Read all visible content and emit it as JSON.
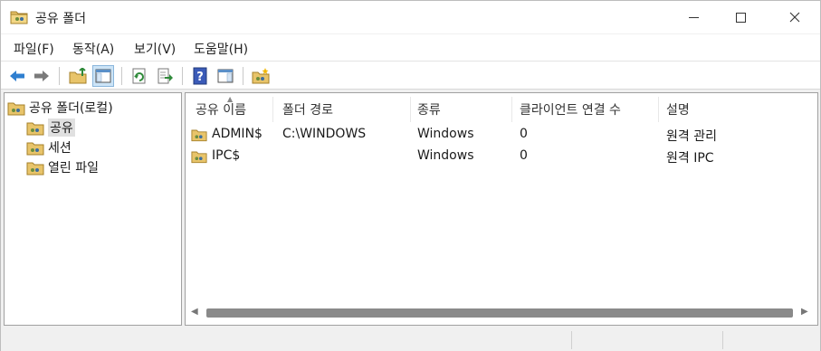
{
  "window": {
    "title": "공유 폴더"
  },
  "menubar": {
    "items": [
      "파일(F)",
      "동작(A)",
      "보기(V)",
      "도움말(H)"
    ]
  },
  "toolbar": {
    "buttons": [
      {
        "icon": "back-arrow-icon"
      },
      {
        "icon": "forward-arrow-icon"
      },
      {
        "icon": "up-folder-icon"
      },
      {
        "icon": "show-hide-tree-icon"
      },
      {
        "icon": "refresh-icon"
      },
      {
        "icon": "export-list-icon"
      },
      {
        "icon": "help-icon"
      },
      {
        "icon": "properties-pane-icon"
      },
      {
        "icon": "new-share-icon"
      }
    ]
  },
  "tree": {
    "root": "공유 폴더(로컬)",
    "items": [
      "공유",
      "세션",
      "열린 파일"
    ],
    "selected": "공유"
  },
  "list": {
    "columns": [
      "공유 이름",
      "폴더 경로",
      "종류",
      "클라이언트 연결 수",
      "설명"
    ],
    "rows": [
      {
        "name": "ADMIN$",
        "path": "C:\\WINDOWS",
        "type": "Windows",
        "connections": "0",
        "description": "원격 관리"
      },
      {
        "name": "IPC$",
        "path": "",
        "type": "Windows",
        "connections": "0",
        "description": "원격 IPC"
      }
    ]
  },
  "colors": {
    "selection": "#e0e0e0",
    "toolbar_active": "#cce4f7",
    "scroll_thumb": "#8a8a8a"
  }
}
